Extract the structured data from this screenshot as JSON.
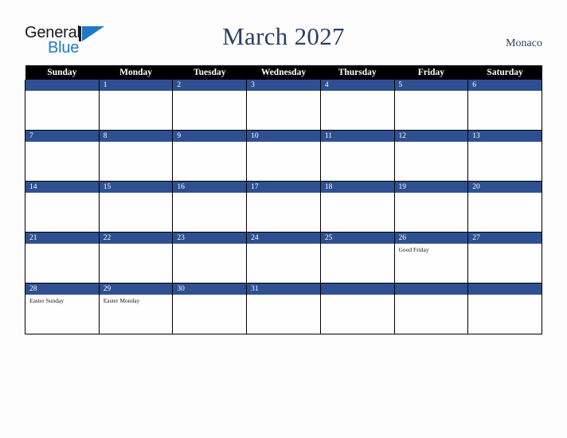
{
  "logo": {
    "line1": "General",
    "line2": "Blue",
    "mark": "flag-triangle-icon"
  },
  "header": {
    "title": "March 2027",
    "region": "Monaco"
  },
  "colors": {
    "accent_blue": "#2e5090",
    "logo_blue": "#1f7ac4",
    "title_navy": "#2b3f63",
    "header_bar": "#000000",
    "page_bg": "#fdfdfd"
  },
  "calendar": {
    "weekday_headers": [
      "Sunday",
      "Monday",
      "Tuesday",
      "Wednesday",
      "Thursday",
      "Friday",
      "Saturday"
    ],
    "weeks": [
      [
        {
          "day": "",
          "events": []
        },
        {
          "day": "1",
          "events": []
        },
        {
          "day": "2",
          "events": []
        },
        {
          "day": "3",
          "events": []
        },
        {
          "day": "4",
          "events": []
        },
        {
          "day": "5",
          "events": []
        },
        {
          "day": "6",
          "events": []
        }
      ],
      [
        {
          "day": "7",
          "events": []
        },
        {
          "day": "8",
          "events": []
        },
        {
          "day": "9",
          "events": []
        },
        {
          "day": "10",
          "events": []
        },
        {
          "day": "11",
          "events": []
        },
        {
          "day": "12",
          "events": []
        },
        {
          "day": "13",
          "events": []
        }
      ],
      [
        {
          "day": "14",
          "events": []
        },
        {
          "day": "15",
          "events": []
        },
        {
          "day": "16",
          "events": []
        },
        {
          "day": "17",
          "events": []
        },
        {
          "day": "18",
          "events": []
        },
        {
          "day": "19",
          "events": []
        },
        {
          "day": "20",
          "events": []
        }
      ],
      [
        {
          "day": "21",
          "events": []
        },
        {
          "day": "22",
          "events": []
        },
        {
          "day": "23",
          "events": []
        },
        {
          "day": "24",
          "events": []
        },
        {
          "day": "25",
          "events": []
        },
        {
          "day": "26",
          "events": [
            "Good Friday"
          ]
        },
        {
          "day": "27",
          "events": []
        }
      ],
      [
        {
          "day": "28",
          "events": [
            "Easter Sunday"
          ]
        },
        {
          "day": "29",
          "events": [
            "Easter Monday"
          ]
        },
        {
          "day": "30",
          "events": []
        },
        {
          "day": "31",
          "events": []
        },
        {
          "day": "",
          "events": []
        },
        {
          "day": "",
          "events": []
        },
        {
          "day": "",
          "events": []
        }
      ]
    ]
  }
}
